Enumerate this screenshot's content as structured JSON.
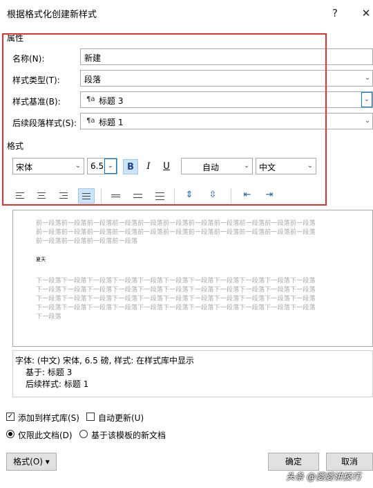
{
  "window": {
    "title": "根据格式化创建新样式",
    "help_label": "?",
    "close_label": "✕"
  },
  "properties": {
    "section_label": "属性",
    "name_label": "名称(N):",
    "name_value": "新建",
    "style_type_label": "样式类型(T):",
    "style_type_value": "段落",
    "style_based_label": "样式基准(B):",
    "style_based_value": "标题 3",
    "next_style_label": "后续段落样式(S):",
    "next_style_value": "标题 1",
    "para_glyph": "¶a"
  },
  "format": {
    "section_label": "格式",
    "font_value": "宋体",
    "size_value": "6.5",
    "bold_label": "B",
    "italic_label": "I",
    "underline_label": "U",
    "color_value": "自动",
    "script_value": "中文"
  },
  "preview": {
    "prev_lines": [
      "前一段落前一段落前一段落前一段落前一段落前一段落前一段落前一段落前一段落前一段落前一段落",
      "前一段落前一段落前一段落前一段落前一段落前一段落前一段落前一段落前一段落前一段落前一段落",
      "前一段落前一段落前一段落前一段落"
    ],
    "sample_text": "夏天",
    "next_lines": [
      "下一段落下一段落下一段落下一段落下一段落下一段落下一段落下一段落下一段落下一段落下一段落",
      "下一段落下一段落下一段落下一段落下一段落下一段落下一段落下一段落下一段落下一段落下一段落",
      "下一段落下一段落下一段落下一段落下一段落下一段落下一段落下一段落下一段落下一段落下一段落",
      "下一段落下一段落下一段落下一段落下一段落下一段落下一段落下一段落下一段落下一段落下一段落",
      "下一段落"
    ]
  },
  "description": {
    "line1": "字体: (中文) 宋体, 6.5 磅, 样式: 在样式库中显示",
    "line2": "基于: 标题 3",
    "line3": "后续样式: 标题 1"
  },
  "options": {
    "add_to_gallery_label": "添加到样式库(S)",
    "add_to_gallery_checked": true,
    "auto_update_label": "自动更新(U)",
    "auto_update_checked": false,
    "only_this_doc_label": "仅限此文档(D)",
    "template_docs_label": "基于该模板的新文档"
  },
  "footer": {
    "format_button_label": "格式(O) ▾",
    "ok_label": "确定",
    "cancel_label": "取消"
  },
  "watermark": "头条 @婆婆讲技巧",
  "colors": {
    "highlight": "#cce4f7",
    "annotation_red": "#e53030",
    "focus_blue": "#0078d7"
  }
}
